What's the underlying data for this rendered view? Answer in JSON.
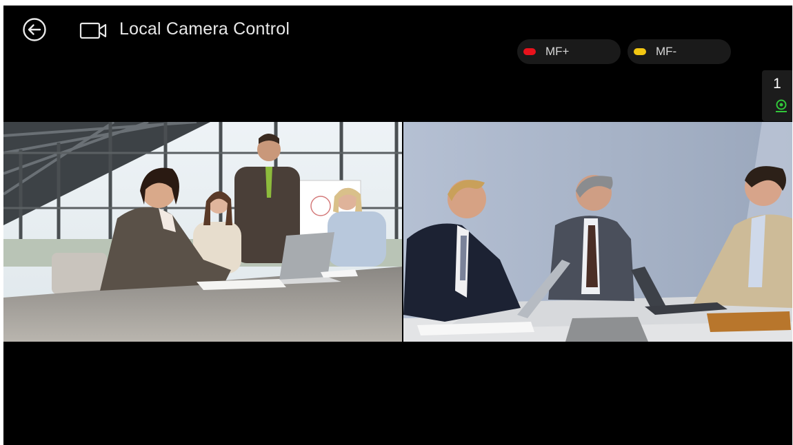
{
  "header": {
    "title": "Local Camera Control",
    "back_icon": "arrow-left-circle-icon",
    "camera_icon": "video-camera-icon"
  },
  "softkeys": [
    {
      "label": "MF+",
      "color": "#e8121c"
    },
    {
      "label": "MF-",
      "color": "#f2c612"
    }
  ],
  "side_panel": {
    "camera_number": "1",
    "source_icon": "camera-source-icon",
    "source_color": "#31c83a"
  },
  "videos": [
    {
      "name": "left-video-feed",
      "content": "photo"
    },
    {
      "name": "right-video-feed",
      "content": "photo"
    }
  ]
}
